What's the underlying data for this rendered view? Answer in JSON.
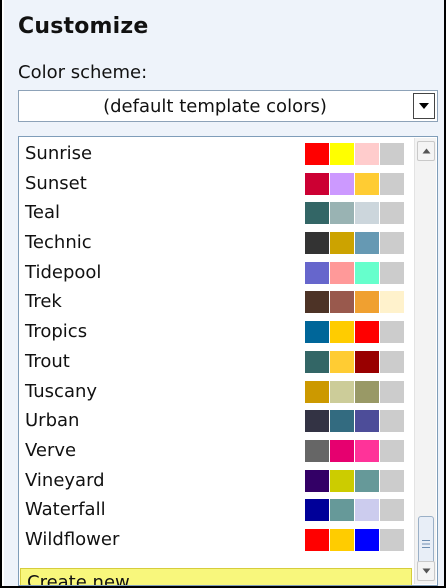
{
  "section_title": "Customize",
  "color_scheme": {
    "label": "Color scheme:",
    "selected": "(default template colors)"
  },
  "schemes": [
    {
      "name": "Sunrise",
      "colors": [
        "#ff0000",
        "#ffff00",
        "#ffcccc",
        "#cccccc"
      ]
    },
    {
      "name": "Sunset",
      "colors": [
        "#cc0033",
        "#cc99ff",
        "#ffcc33",
        "#cccccc"
      ]
    },
    {
      "name": "Teal",
      "colors": [
        "#336666",
        "#99b3b3",
        "#ccd6dc",
        "#cccccc"
      ]
    },
    {
      "name": "Technic",
      "colors": [
        "#333333",
        "#cca300",
        "#6699b3",
        "#cccccc"
      ]
    },
    {
      "name": "Tidepool",
      "colors": [
        "#6666cc",
        "#ff9999",
        "#66ffcc",
        "#cccccc"
      ]
    },
    {
      "name": "Trek",
      "colors": [
        "#4d3326",
        "#99594d",
        "#f0a030",
        "#fff2cc"
      ]
    },
    {
      "name": "Tropics",
      "colors": [
        "#006699",
        "#ffcc00",
        "#ff0000",
        "#cccccc"
      ]
    },
    {
      "name": "Trout",
      "colors": [
        "#336666",
        "#ffcc33",
        "#990000",
        "#cccccc"
      ]
    },
    {
      "name": "Tuscany",
      "colors": [
        "#cc9900",
        "#cccc99",
        "#999966",
        "#cccccc"
      ]
    },
    {
      "name": "Urban",
      "colors": [
        "#333344",
        "#336b80",
        "#4d4d99",
        "#cccccc"
      ]
    },
    {
      "name": "Verve",
      "colors": [
        "#666666",
        "#e6006f",
        "#ff3399",
        "#cccccc"
      ]
    },
    {
      "name": "Vineyard",
      "colors": [
        "#330066",
        "#cccc00",
        "#669999",
        "#cccccc"
      ]
    },
    {
      "name": "Waterfall",
      "colors": [
        "#000099",
        "#669999",
        "#ccccee",
        "#cccccc"
      ]
    },
    {
      "name": "Wildflower",
      "colors": [
        "#ff0000",
        "#ffcc00",
        "#0000ff",
        "#cccccc"
      ]
    }
  ],
  "create_new_label": "Create new...",
  "colors": {
    "panel_background": "#eef3fa",
    "create_highlight": "#f8f77c"
  },
  "icons": {
    "dropdown": "chevron-down-icon",
    "scroll_up": "scroll-up-arrow-icon",
    "scroll_down": "scroll-down-arrow-icon",
    "scroll_thumb_grip": "grip-lines-icon"
  }
}
